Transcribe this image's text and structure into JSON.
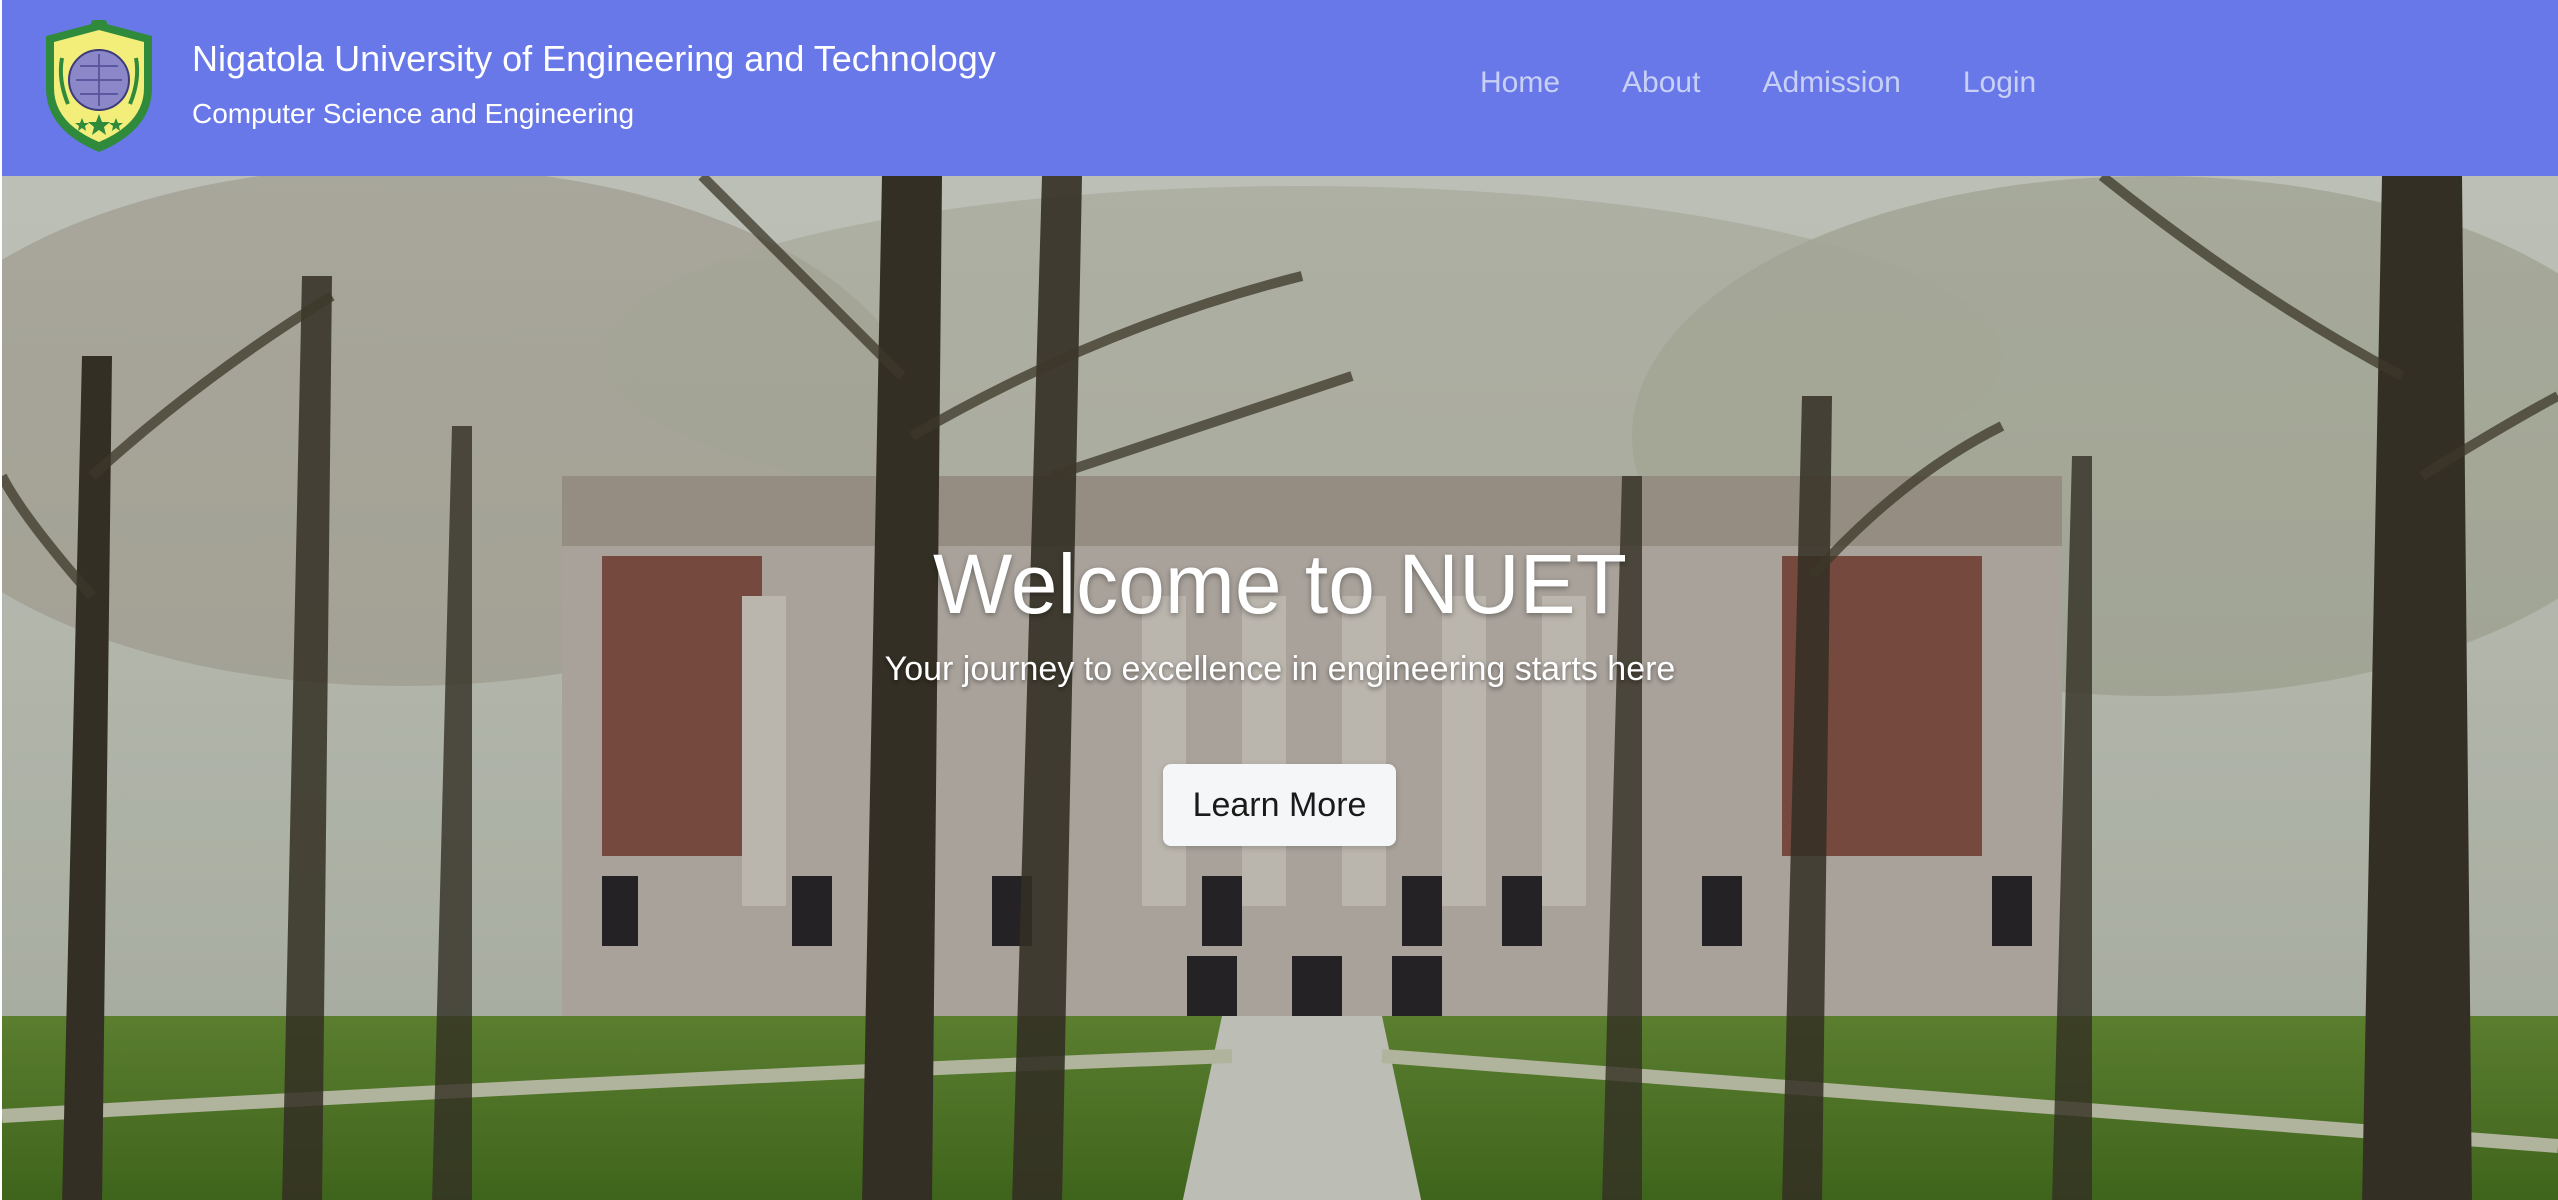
{
  "header": {
    "title": "Nigatola University of Engineering and Technology",
    "subtitle": "Computer Science and Engineering",
    "logo_icon": "university-crest-icon",
    "background_color": "#6978e8"
  },
  "nav": {
    "items": [
      {
        "label": "Home"
      },
      {
        "label": "About"
      },
      {
        "label": "Admission"
      },
      {
        "label": "Login"
      }
    ]
  },
  "hero": {
    "title": "Welcome to NUET",
    "subtitle": "Your journey to excellence in engineering starts here",
    "button_label": "Learn More",
    "background_image": "campus-building-with-trees"
  }
}
